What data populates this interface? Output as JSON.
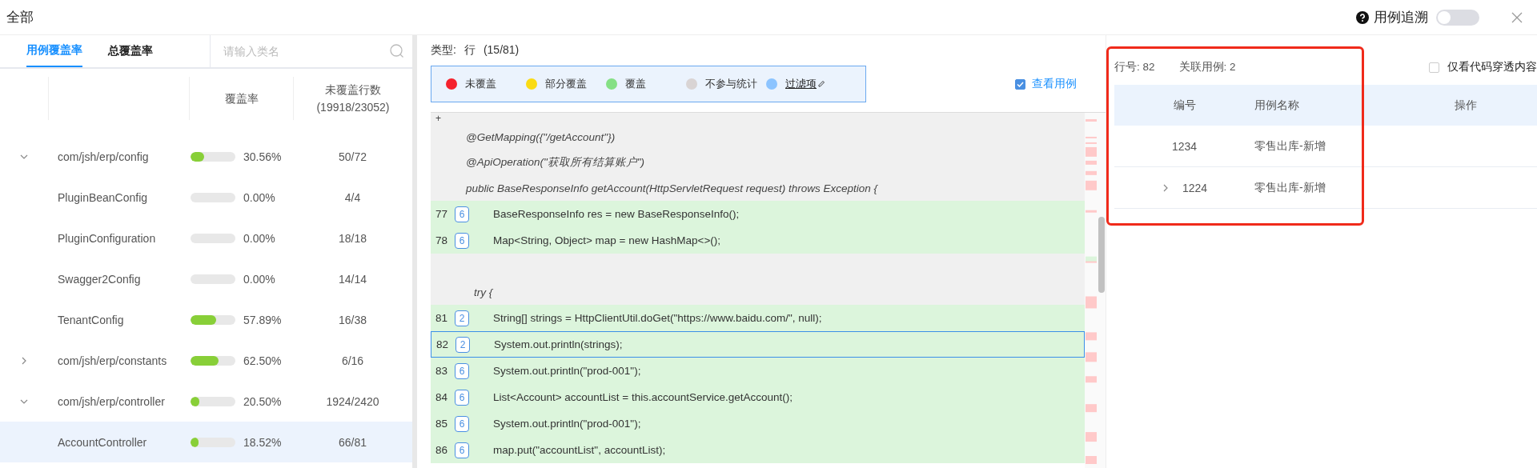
{
  "title": "全部",
  "trace_toggle": {
    "label": "用例追溯",
    "on": false
  },
  "coverage_panel": {
    "tabs": [
      {
        "label": "用例覆盖率",
        "selected": true
      },
      {
        "label": "总覆盖率",
        "selected": false
      }
    ],
    "search": {
      "placeholder": "请输入类名"
    },
    "columns": [
      {
        "label": "覆盖率"
      },
      {
        "label": "未覆盖行数",
        "sub": "(19918/23052)"
      }
    ],
    "rows": [
      {
        "name": "com/jsh/erp/config",
        "expanded": true,
        "level": 0.3056,
        "rate": "30.56%",
        "uncovered": "50/72",
        "selected": false,
        "children": [
          {
            "name": "PluginBeanConfig",
            "level": 0,
            "rate": "0.00%",
            "uncovered": "4/4",
            "selected": false
          },
          {
            "name": "PluginConfiguration",
            "level": 0,
            "rate": "0.00%",
            "uncovered": "18/18",
            "selected": false
          },
          {
            "name": "Swagger2Config",
            "level": 0,
            "rate": "0.00%",
            "uncovered": "14/14",
            "selected": false
          },
          {
            "name": "TenantConfig",
            "level": 0.5789,
            "rate": "57.89%",
            "uncovered": "16/38",
            "selected": false
          }
        ]
      },
      {
        "name": "com/jsh/erp/constants",
        "expanded": false,
        "level": 0.625,
        "rate": "62.50%",
        "uncovered": "6/16",
        "selected": false
      },
      {
        "name": "com/jsh/erp/controller",
        "expanded": true,
        "level": 0.205,
        "rate": "20.50%",
        "uncovered": "1924/2420",
        "selected": false,
        "children": [
          {
            "name": "AccountController",
            "level": 0.1852,
            "rate": "18.52%",
            "uncovered": "66/81",
            "selected": true
          }
        ]
      }
    ]
  },
  "code_panel": {
    "type_label": "类型:",
    "type_value": "行",
    "count": "(15/81)",
    "legend": [
      {
        "label": "未覆盖",
        "color": "#f5222d",
        "kind": "plain"
      },
      {
        "label": "部分覆盖",
        "color": "#fadb14",
        "kind": "plain"
      },
      {
        "label": "覆盖",
        "color": "#85e085",
        "kind": "plain"
      },
      {
        "label": "不参与统计",
        "color": "#d9d4d4",
        "kind": "plain"
      },
      {
        "label": "过滤项",
        "color": "#8cc4ff",
        "kind": "link"
      }
    ],
    "view_cases": {
      "label": "查看用例",
      "checked": true
    },
    "lines": [
      {
        "kind": "marker",
        "text": "+",
        "selected": false
      },
      {
        "kind": "plain",
        "text": "@GetMapping({\"/getAccount\"})",
        "selected": false
      },
      {
        "kind": "plain",
        "text": "@ApiOperation(\"获取所有结算账户\")",
        "selected": false
      },
      {
        "kind": "plain",
        "text": "public BaseResponseInfo getAccount(HttpServletRequest request) throws Exception {",
        "selected": false
      },
      {
        "kind": "covered",
        "number": "77",
        "hits": "6",
        "text": "BaseResponseInfo res = new BaseResponseInfo();",
        "selected": false
      },
      {
        "kind": "covered",
        "number": "78",
        "hits": "6",
        "text": "Map<String, Object> map = new HashMap<>();",
        "selected": false
      },
      {
        "kind": "blank",
        "selected": false
      },
      {
        "kind": "block",
        "text": "try {",
        "selected": false
      },
      {
        "kind": "covered",
        "number": "81",
        "hits": "2",
        "text": "String[] strings = HttpClientUtil.doGet(\"https://www.baidu.com/\", null);",
        "selected": false
      },
      {
        "kind": "covered",
        "number": "82",
        "hits": "2",
        "text": "System.out.println(strings);",
        "selected": true
      },
      {
        "kind": "covered",
        "number": "83",
        "hits": "6",
        "text": "System.out.println(\"prod-001\");",
        "selected": false
      },
      {
        "kind": "covered",
        "number": "84",
        "hits": "6",
        "text": "List<Account> accountList = this.accountService.getAccount();",
        "selected": false
      },
      {
        "kind": "covered",
        "number": "85",
        "hits": "6",
        "text": "System.out.println(\"prod-001\");",
        "selected": false
      },
      {
        "kind": "covered",
        "number": "86",
        "hits": "6",
        "text": "map.put(\"accountList\", accountList);",
        "selected": false
      }
    ]
  },
  "case_panel": {
    "line_label": "行号:",
    "line_no": "82",
    "related_label": "关联用例:",
    "related": "2",
    "only_checkbox": {
      "label": "仅看代码穿透内容",
      "checked": false
    },
    "columns": [
      "编号",
      "用例名称",
      "操作"
    ],
    "rows": [
      {
        "id": "1234",
        "name": "零售出库-新增"
      },
      {
        "id": "1224",
        "name": "零售出库-新增",
        "expanded": false
      }
    ]
  }
}
